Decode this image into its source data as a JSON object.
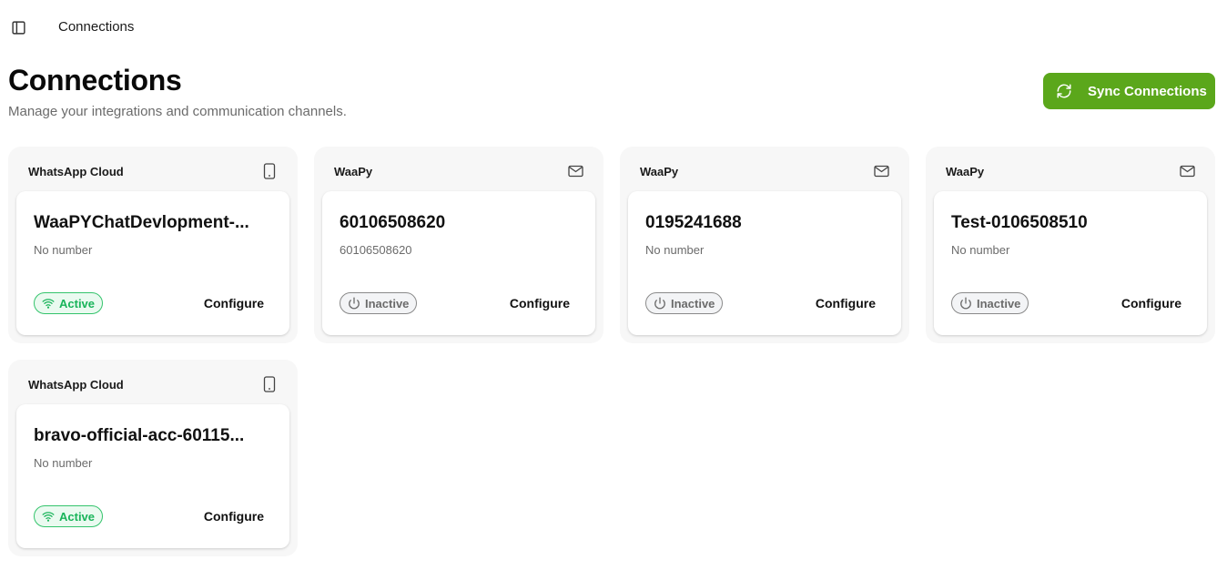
{
  "breadcrumb": {
    "current": "Connections"
  },
  "header": {
    "title": "Connections",
    "subtitle": "Manage your integrations and communication channels.",
    "sync_label": "Sync Connections"
  },
  "colors": {
    "accent": "#5ba71b",
    "active": "#19b45a",
    "inactive": "#6b6b6b"
  },
  "groups": [
    {
      "provider": "WhatsApp Cloud",
      "icon": "smartphone-icon",
      "card": {
        "name": "WaaPYChatDevlopment-...",
        "number": "No number",
        "status": "Active",
        "action": "Configure"
      }
    },
    {
      "provider": "WaaPy",
      "icon": "mail-icon",
      "card": {
        "name": "60106508620",
        "number": "60106508620",
        "status": "Inactive",
        "action": "Configure"
      }
    },
    {
      "provider": "WaaPy",
      "icon": "mail-icon",
      "card": {
        "name": "0195241688",
        "number": "No number",
        "status": "Inactive",
        "action": "Configure"
      }
    },
    {
      "provider": "WaaPy",
      "icon": "mail-icon",
      "card": {
        "name": "Test-0106508510",
        "number": "No number",
        "status": "Inactive",
        "action": "Configure"
      }
    },
    {
      "provider": "WhatsApp Cloud",
      "icon": "smartphone-icon",
      "card": {
        "name": "bravo-official-acc-60115...",
        "number": "No number",
        "status": "Active",
        "action": "Configure"
      }
    }
  ]
}
